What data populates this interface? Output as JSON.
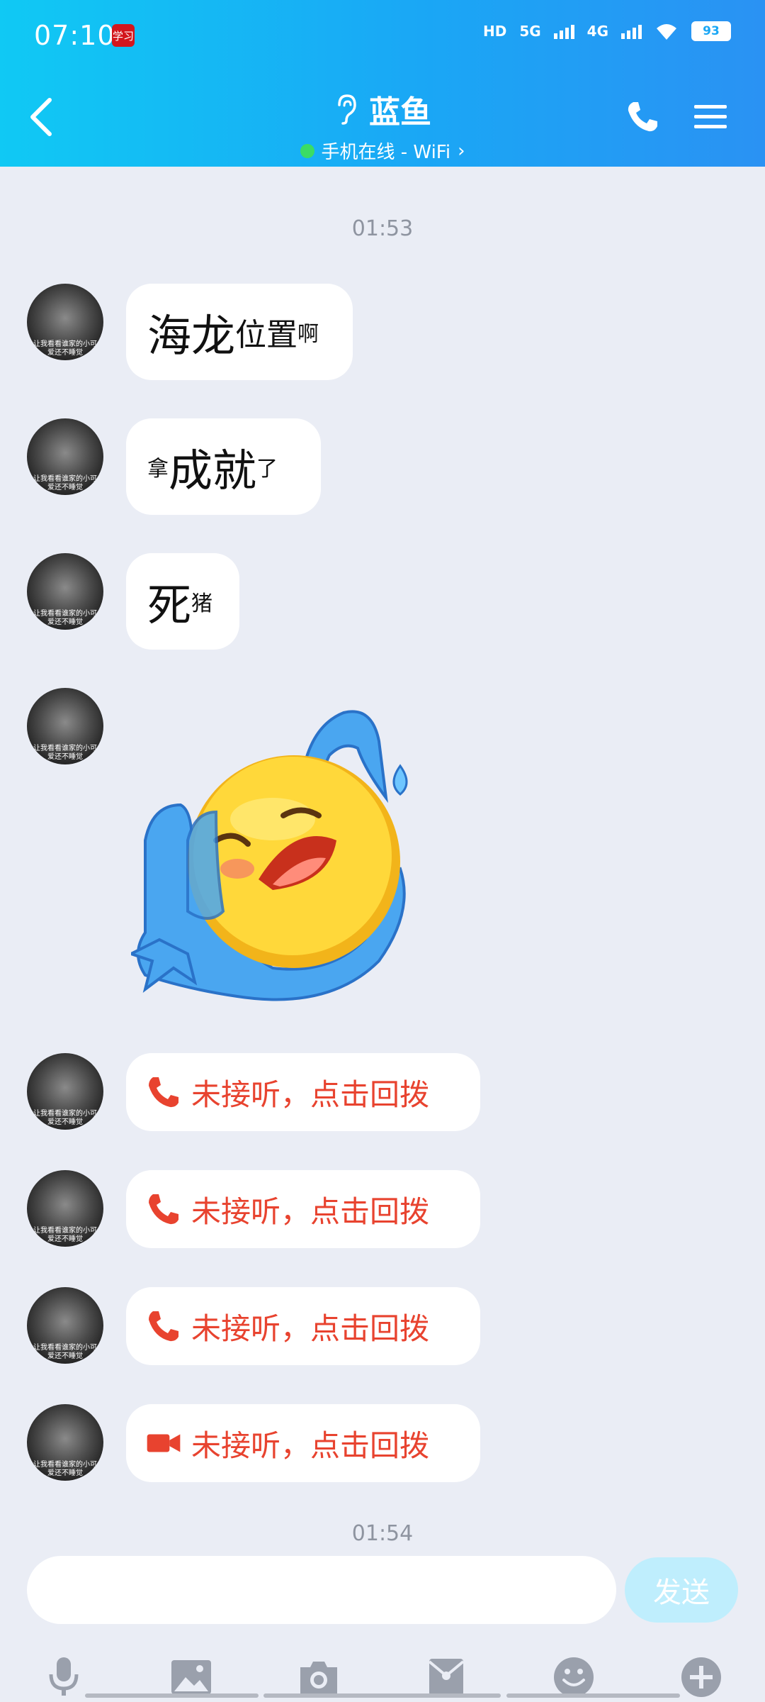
{
  "status_bar": {
    "time": "07:10",
    "notif_badge": "学习",
    "hd": "HD",
    "sim1": "5G",
    "sim2": "4G",
    "battery": "93"
  },
  "header": {
    "title": "蓝鱼",
    "subtitle": "手机在线 - WiFi",
    "subtitle_chevron": "›"
  },
  "chat": {
    "timestamp_1": "01:53",
    "timestamp_2": "01:54",
    "avatar_caption_1": "让我看看谁家的小可",
    "avatar_caption_2": "爱还不睡觉",
    "messages": [
      {
        "parts": [
          "海龙",
          "位置",
          "啊"
        ]
      },
      {
        "parts": [
          "拿",
          "成就",
          "了"
        ]
      },
      {
        "parts": [
          "死",
          "猪"
        ]
      }
    ],
    "missed_calls": [
      {
        "type": "voice",
        "text": "未接听，点击回拨"
      },
      {
        "type": "voice",
        "text": "未接听，点击回拨"
      },
      {
        "type": "voice",
        "text": "未接听，点击回拨"
      },
      {
        "type": "video",
        "text": "未接听，点击回拨"
      }
    ]
  },
  "composer": {
    "input_value": "",
    "send_label": "发送"
  },
  "colors": {
    "header_start": "#10c9f4",
    "header_end": "#2a92f3",
    "missed_call": "#e8432f",
    "send_disabled": "#bfeefd",
    "online": "#3bdc65"
  },
  "icons": {
    "toolbar": [
      "microphone-icon",
      "image-icon",
      "camera-icon",
      "red-packet-icon",
      "emoji-icon",
      "plus-icon"
    ]
  }
}
